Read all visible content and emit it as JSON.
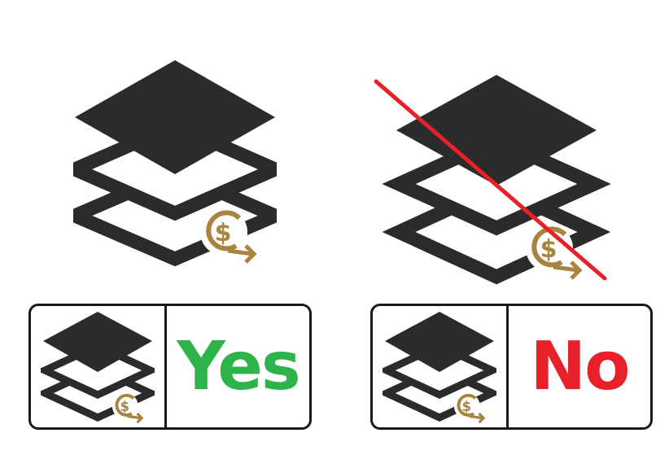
{
  "options": {
    "yes": {
      "label": "Yes",
      "color": "#2db34a",
      "icon": "layers-cost-icon"
    },
    "no": {
      "label": "No",
      "color": "#e8202a",
      "icon": "layers-cost-icon"
    }
  },
  "colors": {
    "icon_dark": "#2b2b2b",
    "coin_gold": "#a8843f",
    "strike_red": "#e8202a",
    "border": "#1a1a1a"
  }
}
